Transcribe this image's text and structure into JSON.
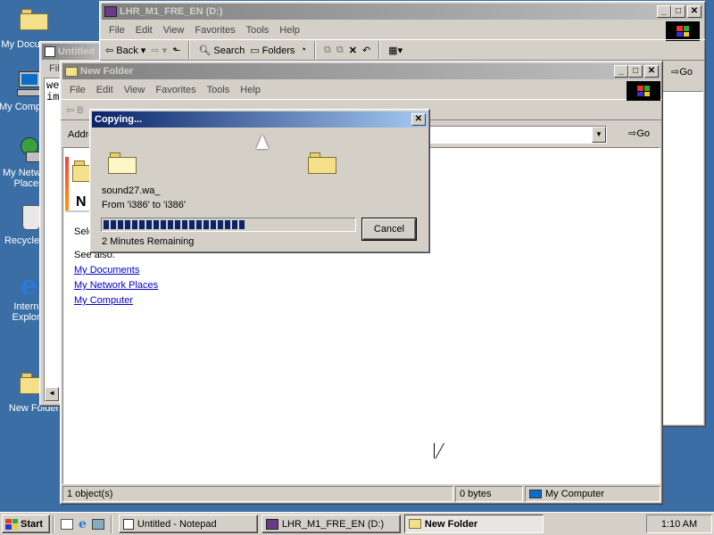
{
  "desktop": {
    "icons": [
      {
        "label": "My Documents"
      },
      {
        "label": "My Computer"
      },
      {
        "label": "My Network Places"
      },
      {
        "label": "Recycle Bin"
      },
      {
        "label": "Internet Explorer"
      },
      {
        "label": "New Folder"
      }
    ]
  },
  "notepad": {
    "title": "Untitled - Notepad",
    "menu_first": "File",
    "text_line1": "we",
    "text_line2": "im"
  },
  "drive_window": {
    "title": "LHR_M1_FRE_EN (D:)",
    "menu": [
      "File",
      "Edit",
      "View",
      "Favorites",
      "Tools",
      "Help"
    ],
    "toolbar": {
      "back": "Back",
      "search": "Search",
      "folders": "Folders",
      "go": "Go"
    }
  },
  "folder_window": {
    "title": "New Folder",
    "menu": [
      "File",
      "Edit",
      "View",
      "Favorites",
      "Tools",
      "Help"
    ],
    "toolbar": {
      "back": "B"
    },
    "address_label": "Addre",
    "go": "Go",
    "panel_title_fragment": "N",
    "select_text": "Sele",
    "see_also": "See also:",
    "links": [
      "My Documents",
      "My Network Places",
      "My Computer"
    ],
    "status": {
      "objects": "1 object(s)",
      "size": "0 bytes",
      "zone": "My Computer"
    }
  },
  "copy_dialog": {
    "title": "Copying...",
    "filename": "sound27.wa_",
    "from_to": "From 'i386' to 'i386'",
    "remaining": "2 Minutes Remaining",
    "cancel": "Cancel",
    "progress": 0.57
  },
  "taskbar": {
    "start": "Start",
    "buttons": [
      {
        "label": "Untitled - Notepad"
      },
      {
        "label": "LHR_M1_FRE_EN (D:)"
      },
      {
        "label": "New Folder"
      }
    ],
    "clock": "1:10 AM"
  },
  "colors": {
    "desktop": "#3a6ea5",
    "active_title": "#0a246a",
    "progress": "#0a246a"
  }
}
